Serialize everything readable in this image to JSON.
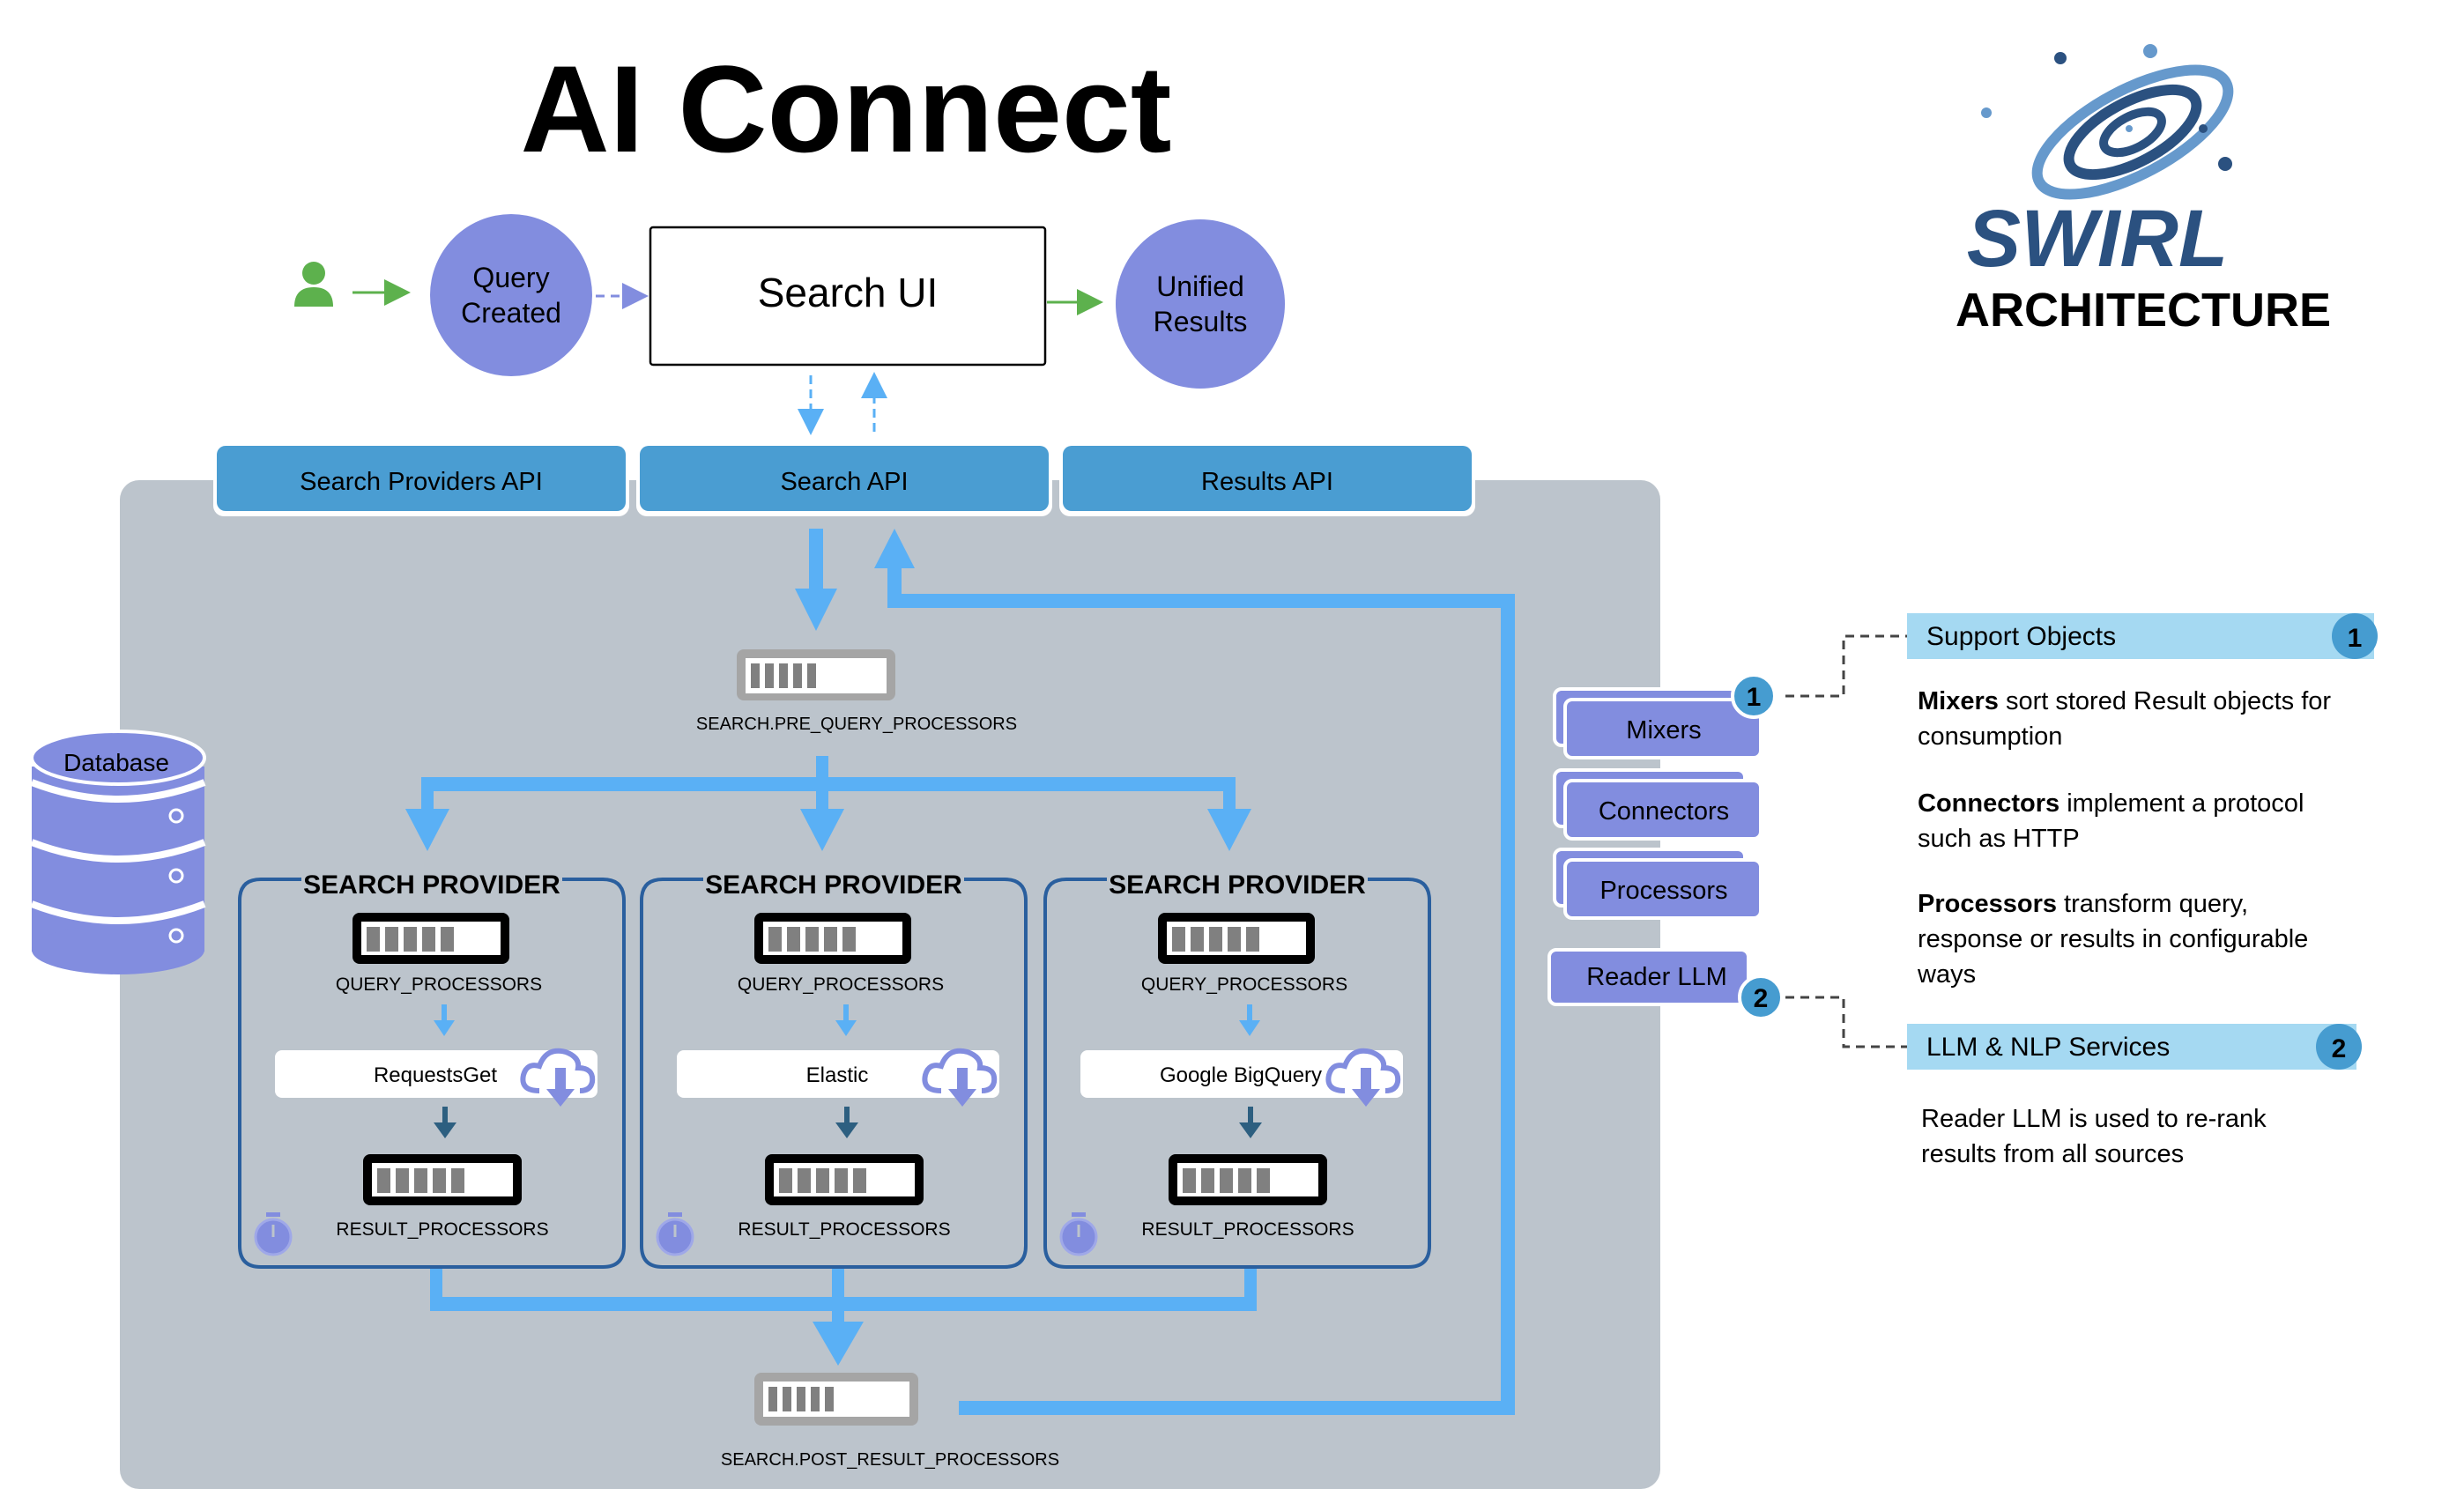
{
  "header": {
    "title": "AI Connect",
    "brand": "SWIRL",
    "subtitle": "ARCHITECTURE"
  },
  "flow": {
    "query_created": [
      "Query",
      "Created"
    ],
    "search_ui": "Search UI",
    "unified_results": [
      "Unified",
      "Results"
    ]
  },
  "apis": [
    {
      "label": "Search Providers API"
    },
    {
      "label": "Search API"
    },
    {
      "label": "Results API"
    }
  ],
  "pipeline": {
    "pre_query": "SEARCH.PRE_QUERY_PROCESSORS",
    "post_result": "SEARCH.POST_RESULT_PROCESSORS",
    "database": "Database"
  },
  "providers": [
    {
      "title": "SEARCH PROVIDER",
      "query_processors": "QUERY_PROCESSORS",
      "connector": "RequestsGet",
      "result_processors": "RESULT_PROCESSORS"
    },
    {
      "title": "SEARCH PROVIDER",
      "query_processors": "QUERY_PROCESSORS",
      "connector": "Elastic",
      "result_processors": "RESULT_PROCESSORS"
    },
    {
      "title": "SEARCH PROVIDER",
      "query_processors": "QUERY_PROCESSORS",
      "connector": "Google BigQuery",
      "result_processors": "RESULT_PROCESSORS"
    }
  ],
  "support_stack": [
    {
      "label": "Mixers"
    },
    {
      "label": "Connectors"
    },
    {
      "label": "Processors"
    },
    {
      "label": "Reader LLM"
    }
  ],
  "legend": {
    "support_objects": {
      "title": "Support Objects",
      "badge": "1"
    },
    "llm_services": {
      "title": "LLM & NLP Services",
      "badge": "2"
    },
    "mixers": {
      "bold": "Mixers",
      "text": " sort stored Result objects for consumption"
    },
    "connectors": {
      "bold": "Connectors",
      "text": " implement a protocol such as HTTP"
    },
    "processors": {
      "bold": "Processors",
      "text": " transform query, response or results in configurable ways"
    },
    "reader_llm": "Reader LLM is used to re-rank results from all sources"
  },
  "colors": {
    "panel": "#bcc4cc",
    "api": "#4a9dd2",
    "flow": "#5ab0f5",
    "purple": "#828ddf",
    "provider_border": "#2a5f9e",
    "badge": "#469cd0",
    "legend_bar": "#a5d9f2",
    "green": "#5db14d",
    "swirl_dark": "#2b5180",
    "swirl_light": "#6699cc"
  }
}
